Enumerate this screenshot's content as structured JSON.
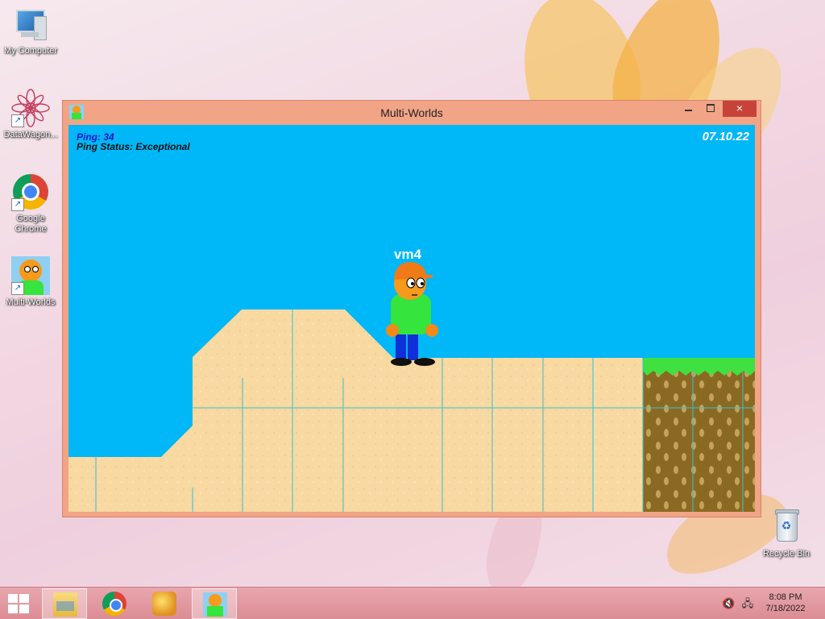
{
  "desktop": {
    "icons": [
      {
        "label": "My Computer",
        "icon": "computer-icon"
      },
      {
        "label": "DataWagon...",
        "icon": "datawagon-flower-icon"
      },
      {
        "label": "Google Chrome",
        "icon": "chrome-icon"
      },
      {
        "label": "Multi-Worlds",
        "icon": "multi-worlds-icon"
      },
      {
        "label": "Recycle Bin",
        "icon": "recycle-bin-icon"
      }
    ]
  },
  "window": {
    "title": "Multi-Worlds",
    "controls": {
      "minimize": "minimize-icon",
      "maximize": "maximize-icon",
      "close": "×"
    }
  },
  "game": {
    "ping_text": "Ping: 34",
    "ping_status_text": "Ping Status: Exceptional",
    "date": "07.10.22",
    "player_name": "vm4",
    "colors": {
      "sky": "#00b7f7",
      "sand": "#f7d9a1",
      "grass": "#3fe03f",
      "dirt": "#8a6a22",
      "grid": "#38c0d8"
    }
  },
  "taskbar": {
    "apps": [
      {
        "name": "File Explorer",
        "icon": "folder-icon"
      },
      {
        "name": "Google Chrome",
        "icon": "chrome-icon"
      },
      {
        "name": "Setup",
        "icon": "setup-icon"
      },
      {
        "name": "Multi-Worlds",
        "icon": "multi-worlds-icon",
        "active": true
      }
    ],
    "time": "8:08 PM",
    "date": "7/18/2022"
  }
}
